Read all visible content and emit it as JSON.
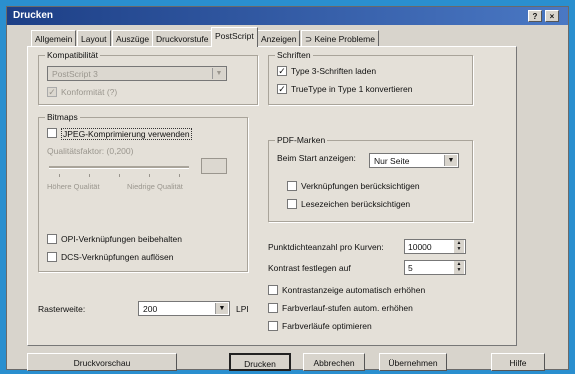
{
  "window": {
    "title": "Drucken"
  },
  "titlebar_buttons": [
    "?",
    "×"
  ],
  "tabs": [
    {
      "label": "Allgemein",
      "active": false
    },
    {
      "label": "Layout",
      "active": false
    },
    {
      "label": "Auszüge",
      "active": false
    },
    {
      "label": "Druckvorstufe",
      "active": false
    },
    {
      "label": "PostScript",
      "active": true
    },
    {
      "label": "Anzeigen",
      "active": false
    },
    {
      "label": "Keine Probleme",
      "active": false
    }
  ],
  "compat": {
    "title": "Kompatibilität",
    "level_value": "PostScript 3",
    "optimize_label": "Konformität (?)"
  },
  "fonts": {
    "title": "Schriften",
    "download_type3": "Type 3-Schriften laden",
    "convert_truetype": "TrueType in Type 1 konvertieren"
  },
  "bitmaps": {
    "title": "Bitmaps",
    "jpeg_label": "JPEG-Komprimierung verwenden",
    "quality_label": "Qualitätsfaktor: (0,200)",
    "smaller_label": "Höhere Qualität",
    "larger_label": "Niedrige Qualität",
    "opi_label": "OPI-Verknüpfungen beibehalten",
    "dcs_label": "DCS-Verknüpfungen auflösen"
  },
  "pdf": {
    "title": "PDF-Marken",
    "start_label": "Beim Start anzeigen:",
    "start_value": "Nur Seite",
    "hyperlinks_label": "Verknüpfungen berücksichtigen",
    "bookmarks_label": "Lesezeichen berücksichtigen"
  },
  "options": {
    "flatness_label": "Punktdichteanzahl pro Kurven:",
    "flatness_value": "10000",
    "fountain_label": "Kontrast festlegen auf",
    "fountain_value": "5",
    "auto_increase_label": "Kontrastanzeige automatisch erhöhen",
    "fountain_auto_label": "Farbverlauf-stufen autom. erhöhen",
    "optimize_fountain_label": "Farbverläufe optimieren"
  },
  "screen": {
    "label": "Rasterweite:",
    "value": "200",
    "unit": "LPI"
  },
  "buttons": {
    "preview": "Druckvorschau",
    "print": "Drucken",
    "cancel": "Abbrechen",
    "apply": "Übernehmen",
    "help": "Hilfe"
  }
}
